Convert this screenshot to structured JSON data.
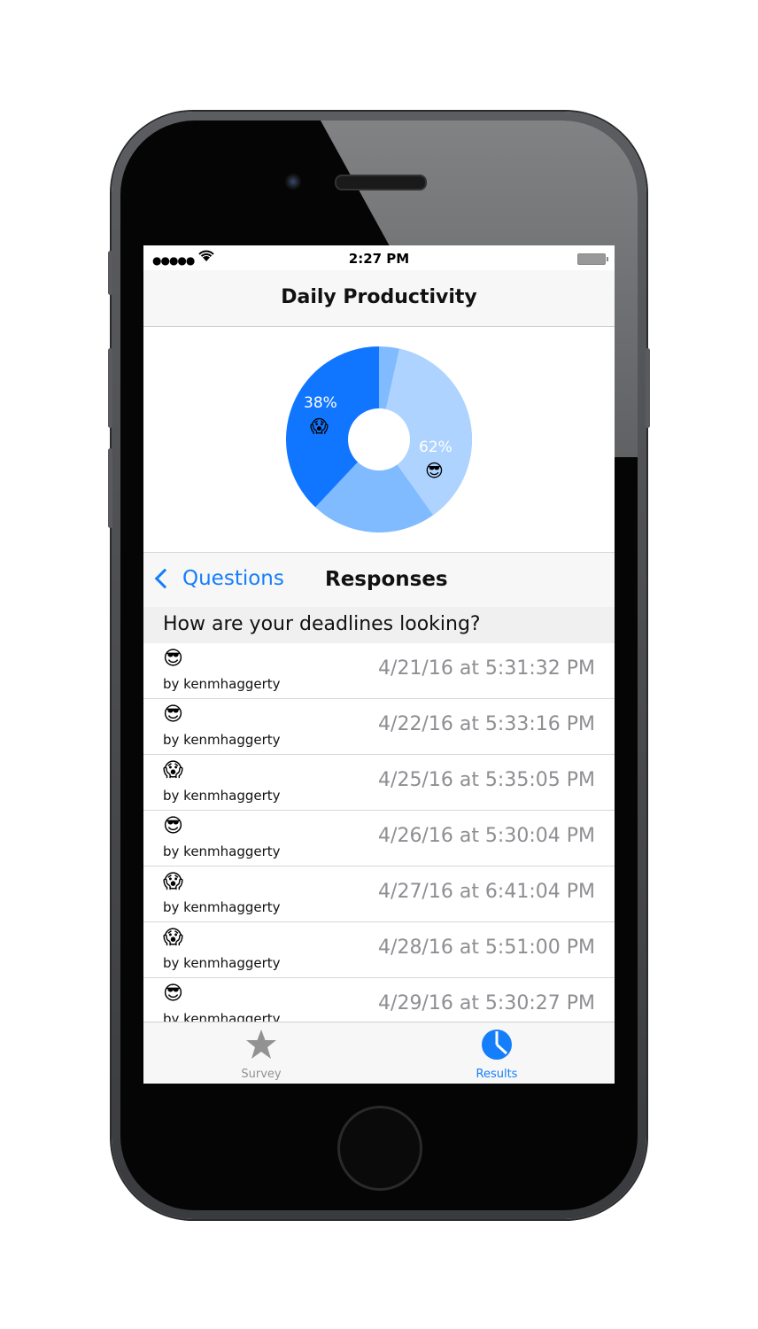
{
  "statusbar": {
    "time": "2:27 PM",
    "signal": "●●●●●"
  },
  "nav": {
    "title": "Daily Productivity"
  },
  "chart_data": {
    "type": "pie",
    "style": "donut",
    "slices": [
      {
        "label": "38%",
        "value": 38,
        "emoji": "😱",
        "color": "#1176ff"
      },
      {
        "label": "62%",
        "value": 62,
        "emoji": "😎",
        "color": "#80bbff"
      }
    ]
  },
  "subnav": {
    "back_label": "Questions",
    "title": "Responses"
  },
  "question": "How are your deadlines looking?",
  "responses": [
    {
      "emoji": "😎",
      "author": "by kenmhaggerty",
      "date": "4/21/16 at 5:31:32 PM"
    },
    {
      "emoji": "😎",
      "author": "by kenmhaggerty",
      "date": "4/22/16 at 5:33:16 PM"
    },
    {
      "emoji": "😱",
      "author": "by kenmhaggerty",
      "date": "4/25/16 at 5:35:05 PM"
    },
    {
      "emoji": "😎",
      "author": "by kenmhaggerty",
      "date": "4/26/16 at 5:30:04 PM"
    },
    {
      "emoji": "😱",
      "author": "by kenmhaggerty",
      "date": "4/27/16 at 6:41:04 PM"
    },
    {
      "emoji": "😱",
      "author": "by kenmhaggerty",
      "date": "4/28/16 at 5:51:00 PM"
    },
    {
      "emoji": "😎",
      "author": "by kenmhaggerty",
      "date": "4/29/16 at 5:30:27 PM"
    }
  ],
  "tabs": [
    {
      "label": "Survey",
      "icon": "star-icon",
      "selected": false,
      "color": "#929292"
    },
    {
      "label": "Results",
      "icon": "pie-chart-icon",
      "selected": true,
      "color": "#157efb"
    }
  ]
}
